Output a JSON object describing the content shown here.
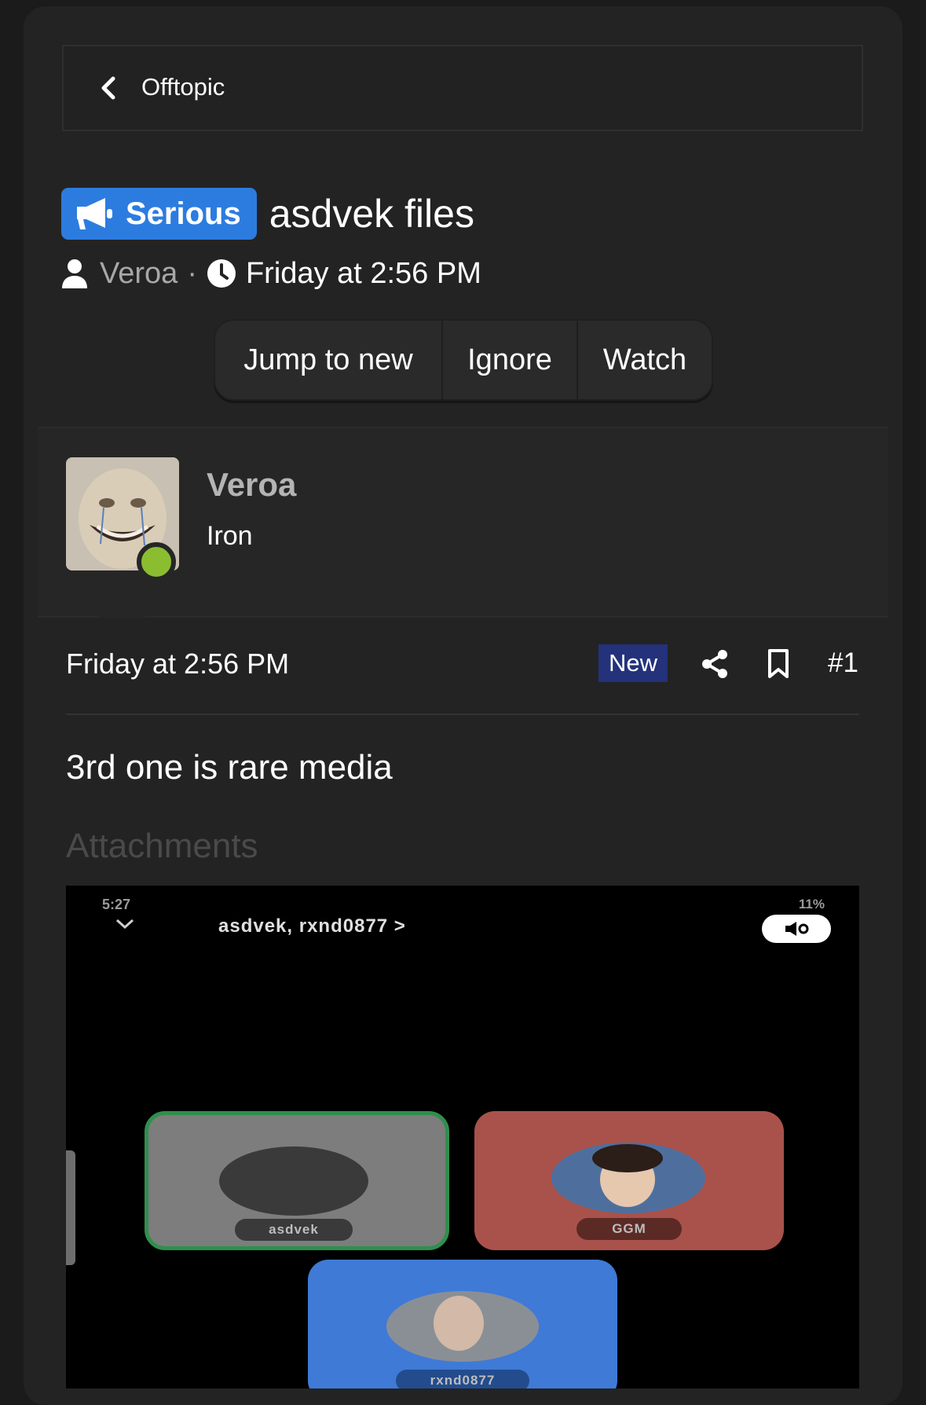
{
  "breadcrumb": {
    "label": "Offtopic"
  },
  "thread": {
    "prefix": "Serious",
    "title": "asdvek files",
    "author": "Veroa",
    "separator": "·",
    "date": "Friday at 2:56 PM"
  },
  "actions": [
    {
      "label": "Jump to new"
    },
    {
      "label": "Ignore"
    },
    {
      "label": "Watch"
    }
  ],
  "post": {
    "user": {
      "name": "Veroa",
      "title": "Iron",
      "online": true
    },
    "date": "Friday at 2:56 PM",
    "badge": "New",
    "number": "#1",
    "body": "3rd one is rare media",
    "attachments_heading": "Attachments"
  },
  "attachment": {
    "time": "5:27",
    "status": "11%",
    "call_title": "asdvek, rxnd0877  >",
    "participants": [
      {
        "name": "asdvek"
      },
      {
        "name": "GGM"
      },
      {
        "name": "rxnd0877"
      }
    ]
  },
  "colors": {
    "prefix": "#2c7ce0",
    "new_badge": "#23327a",
    "online": "#8bbd31",
    "card": "#232323",
    "page": "#1b1b1b"
  },
  "icons": [
    "chevron-left-icon",
    "megaphone-icon",
    "user-icon",
    "clock-icon",
    "share-icon",
    "bookmark-icon"
  ]
}
